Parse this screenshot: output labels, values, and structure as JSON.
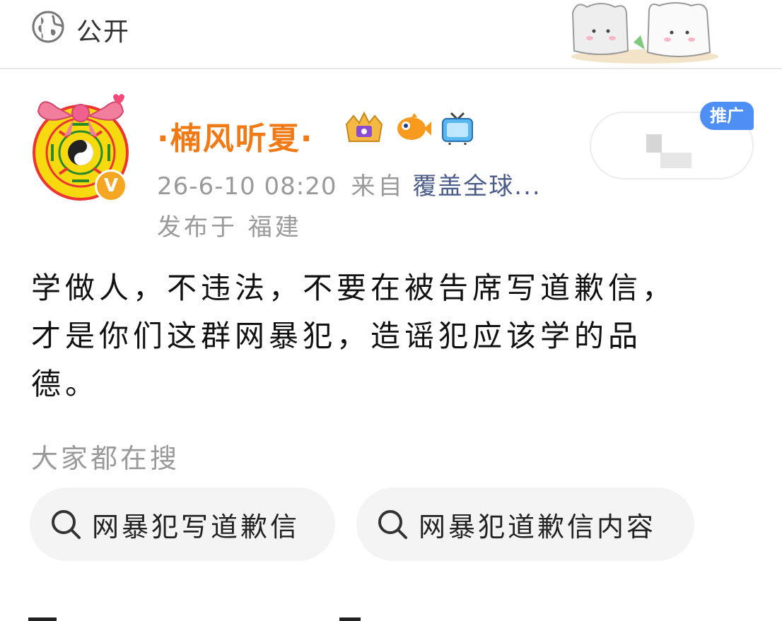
{
  "visibility": {
    "icon": "globe-icon",
    "label": "公开"
  },
  "author": {
    "name": "·楠风听夏·",
    "badges": [
      "crown-badge-icon",
      "fish-badge-icon",
      "tv-badge-icon"
    ],
    "verified_mark": "V"
  },
  "meta": {
    "time": "26-6-10 08:20",
    "from_label": "来自",
    "source": "覆盖全球...",
    "location": "发布于 福建"
  },
  "ad": {
    "tag": "推广"
  },
  "post": {
    "line1": "学做人，不违法，不要在被告席写道歉信，",
    "line2": "才是你们这群网暴犯，造谣犯应该学的品",
    "line3": "德。"
  },
  "trending": {
    "heading": "大家都在搜",
    "items": [
      {
        "label": "网暴犯写道歉信",
        "icon": "search-icon"
      },
      {
        "label": "网暴犯道歉信内容",
        "icon": "search-icon"
      }
    ]
  },
  "colors": {
    "name": "#f07a16",
    "source_link": "#4a5b8a",
    "ad_tag": "#4e8ff6",
    "verified": "#f5a623",
    "muted": "#9a9a9a"
  }
}
